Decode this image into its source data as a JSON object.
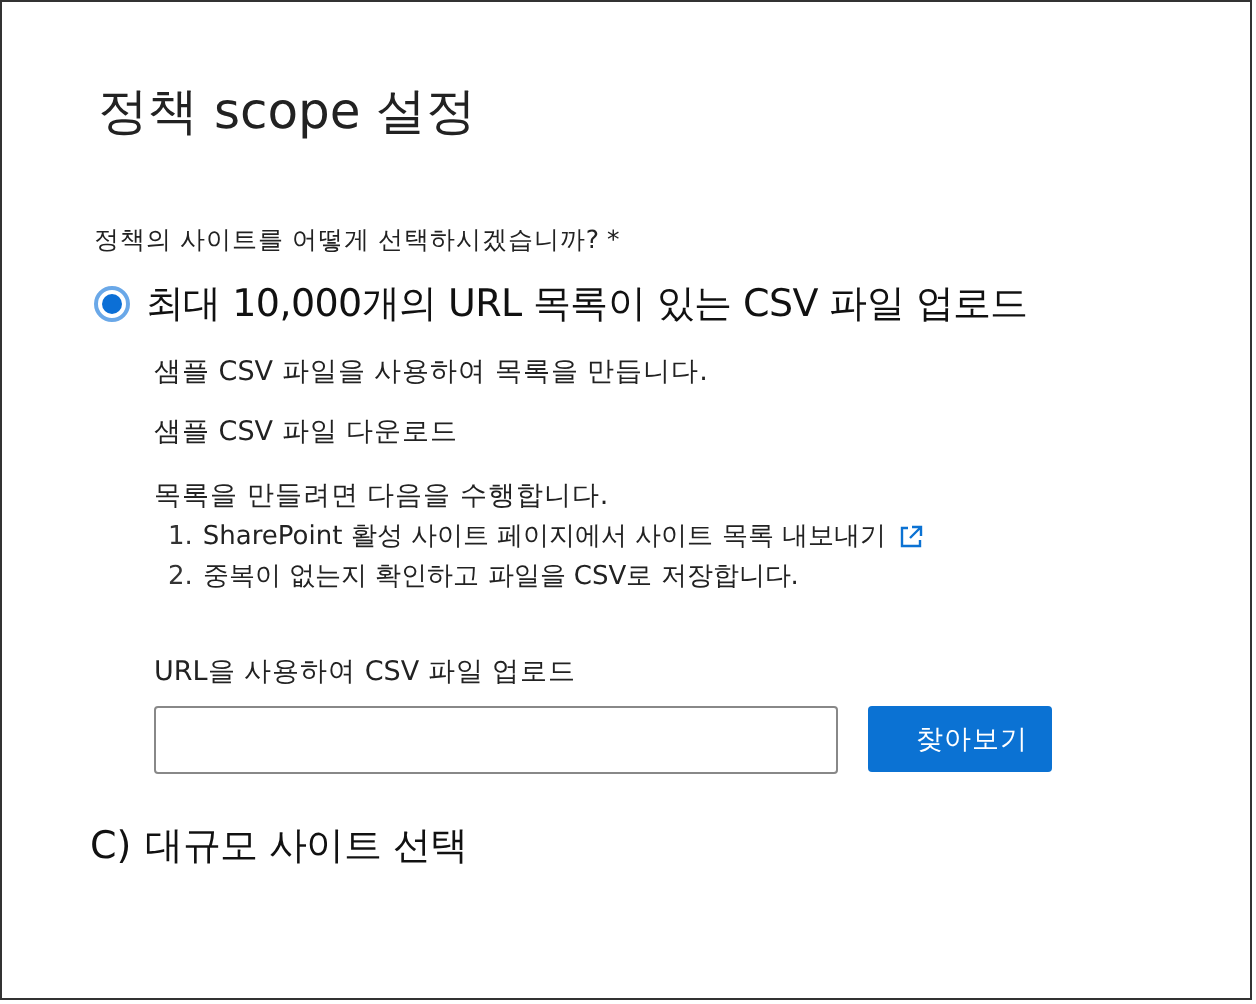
{
  "title": "정책 scope 설정",
  "question": {
    "label": "정책의 사이트를 어떻게 선택하시겠습니까?",
    "required_mark": "*"
  },
  "options": [
    {
      "kind": "radio",
      "label": "최대 10,000개의 URL 목록이 있는 CSV 파일 업로드",
      "selected": true,
      "description": "샘플 CSV 파일을 사용하여 목록을 만듭니다.",
      "download_link": "샘플 CSV 파일 다운로드",
      "steps_intro": "목록을 만들려면 다음을 수행합니다.",
      "steps": [
        {
          "number": "1.",
          "text": "SharePoint 활성 사이트 페이지에서 사이트 목록 내보내기",
          "external": true
        },
        {
          "number": "2.",
          "text": "중복이 없는지 확인하고 파일을 CSV로 저장합니다.",
          "external": false
        }
      ],
      "upload_label": "URL을 사용하여 CSV 파일 업로드",
      "browse_button": "찾아보기"
    },
    {
      "kind": "lettered",
      "marker": "C)",
      "label": "대규모 사이트 선택"
    }
  ]
}
